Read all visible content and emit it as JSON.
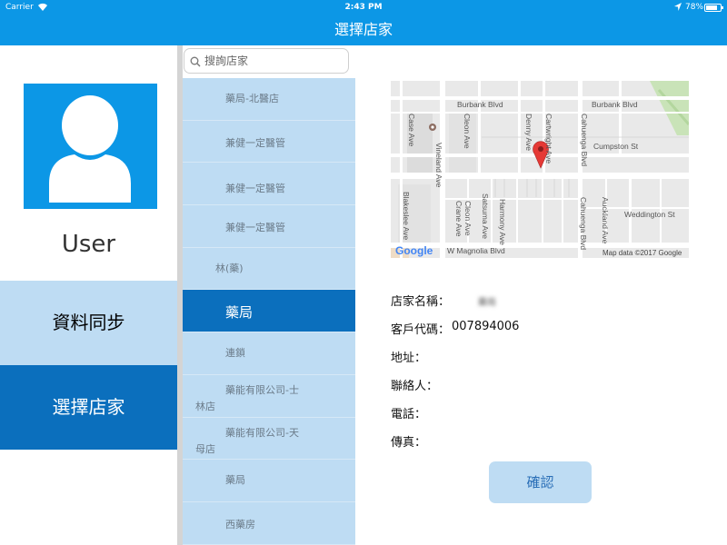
{
  "status_bar": {
    "carrier": "Carrier",
    "time": "2:43 PM",
    "battery": "78%",
    "battery_level": 0.78
  },
  "nav": {
    "title": "選擇店家"
  },
  "left_panel": {
    "username": "User",
    "menu": [
      {
        "label": "資料同步",
        "selected": false
      },
      {
        "label": "選擇店家",
        "selected": true
      }
    ]
  },
  "store_list": {
    "search_placeholder": "搜詢店家",
    "items": [
      {
        "line1": "藥局-北醫店",
        "line2": "",
        "blurred": true,
        "selected": false
      },
      {
        "line1": "兼健一定醫管",
        "line2": "",
        "blurred": true,
        "selected": false
      },
      {
        "line1": "兼健一定醫管",
        "line2": "",
        "blurred": true,
        "selected": false
      },
      {
        "line1": "兼健一定醫管",
        "line2": "",
        "blurred": true,
        "selected": false
      },
      {
        "line1": "林(藥)",
        "line2": "",
        "blurred": true,
        "selected": false
      },
      {
        "line1": "藥局",
        "line2": "",
        "blurred": false,
        "selected": true
      },
      {
        "line1": "連鎖",
        "line2": "",
        "blurred": true,
        "selected": false
      },
      {
        "line1": "藥能有限公司-士",
        "line2": "林店",
        "blurred": true,
        "selected": false
      },
      {
        "line1": "藥能有限公司-天",
        "line2": "母店",
        "blurred": true,
        "selected": false
      },
      {
        "line1": "藥局",
        "line2": "",
        "blurred": true,
        "selected": false
      },
      {
        "line1": "西藥房",
        "line2": "",
        "blurred": true,
        "selected": false
      }
    ]
  },
  "map": {
    "streets": {
      "burbank_left": "Burbank Blvd",
      "burbank_right": "Burbank Blvd",
      "cumpston": "Cumpston St",
      "weddington": "Weddington St",
      "magnolia": "W Magnolia Blvd",
      "case_ave": "Case Ave",
      "cleon_ave_top": "Cleon Ave",
      "denny_ave": "Denny Ave",
      "cartwright_ave": "Cartwright Ave",
      "cahuenga_top": "Cahuenga Blvd",
      "vineland_ave": "Vineland Ave",
      "blakeslee_ave": "Blakeslee Ave",
      "crane_ave": "Crane Ave",
      "cleon_ave_bottom": "Cleon Ave",
      "satsuma_ave": "Satsuma Ave",
      "harmony_ave": "Harmony Ave",
      "cahuenga_bottom": "Cahuenga Blvd",
      "auckland_ave": "Auckland Ave"
    },
    "logo": "Google",
    "attribution": "Map data ©2017 Google",
    "pin_color": "#e53935",
    "road_color": "#ffffff",
    "block_color": "#e8e8e8"
  },
  "store_detail": {
    "name_label": "店家名稱：",
    "name_value": "藥局",
    "code_label": "客戶代碼：",
    "code_value": "007894006",
    "address_label": "地址：",
    "contact_label": "聯絡人：",
    "phone_label": "電話：",
    "fax_label": "傳真：",
    "confirm_label": "確認"
  },
  "colors": {
    "primary": "#0c97e6",
    "selected": "#0b6fbd",
    "light": "#bedcf3"
  }
}
